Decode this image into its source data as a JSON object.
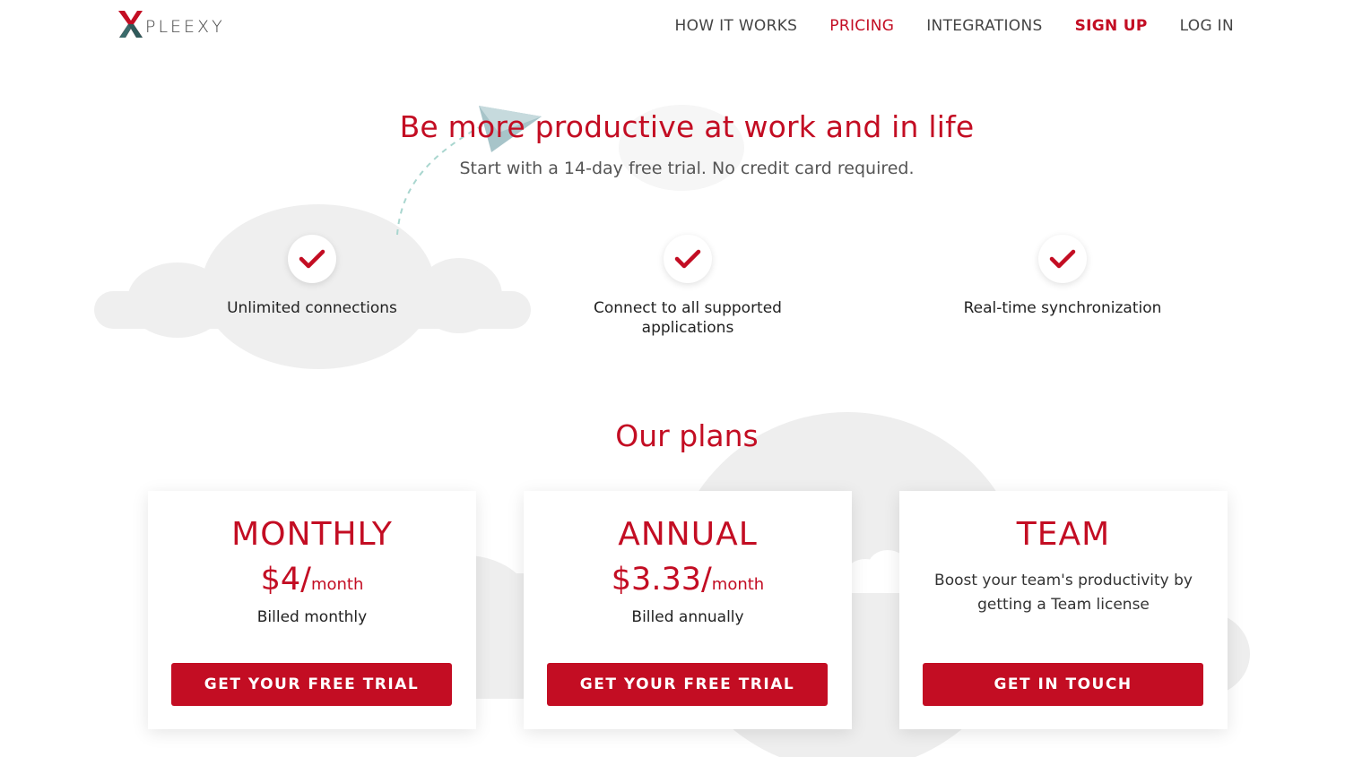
{
  "brand": {
    "name": "PLEEXY",
    "primary_color": "#c30d23",
    "secondary_color": "#3b6b6b"
  },
  "nav": {
    "items": [
      {
        "label": "HOW IT WORKS"
      },
      {
        "label": "PRICING"
      },
      {
        "label": "INTEGRATIONS"
      },
      {
        "label": "SIGN UP"
      },
      {
        "label": "LOG IN"
      }
    ],
    "active": "PRICING"
  },
  "hero": {
    "title": "Be more productive at work and in life",
    "subtitle": "Start with a 14-day free trial. No credit card required."
  },
  "features": [
    {
      "icon": "check-icon",
      "label": "Unlimited connections"
    },
    {
      "icon": "check-icon",
      "label": "Connect to all supported applications"
    },
    {
      "icon": "check-icon",
      "label": "Real-time synchronization"
    }
  ],
  "plans": {
    "title": "Our plans",
    "cards": [
      {
        "name": "MONTHLY",
        "price": "$4/",
        "unit": "month",
        "billing": "Billed monthly",
        "button": "GET YOUR FREE TRIAL"
      },
      {
        "name": "ANNUAL",
        "price": "$3.33/",
        "unit": "month",
        "billing": "Billed annually",
        "button": "GET YOUR FREE TRIAL"
      },
      {
        "name": "TEAM",
        "description": "Boost your team's productivity by getting a Team license",
        "button": "GET IN TOUCH"
      }
    ]
  }
}
